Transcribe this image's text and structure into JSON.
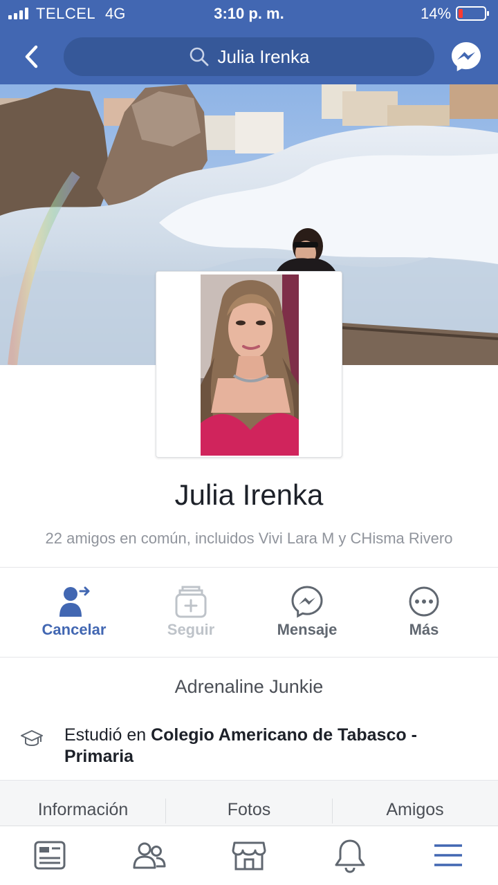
{
  "status_bar": {
    "carrier": "TELCEL",
    "network": "4G",
    "time": "3:10 p. m.",
    "battery": "14%"
  },
  "nav": {
    "search_text": "Julia Irenka",
    "back_icon": "chevron-left-icon",
    "messenger_icon": "messenger-icon"
  },
  "profile": {
    "name": "Julia Irenka",
    "mutual_friends": "22 amigos en común, incluidos Vivi Lara M y CHisma Rivero"
  },
  "actions": [
    {
      "label": "Cancelar",
      "icon": "friend-request-sent-icon"
    },
    {
      "label": "Seguir",
      "icon": "follow-icon"
    },
    {
      "label": "Mensaje",
      "icon": "messenger-icon"
    },
    {
      "label": "Más",
      "icon": "more-icon"
    }
  ],
  "intro": {
    "bio": "Adrenaline Junkie",
    "education_prefix": "Estudió en ",
    "education_school": "Colegio Americano de Tabasco - Primaria"
  },
  "tabs": [
    "Información",
    "Fotos",
    "Amigos"
  ],
  "bottom_nav": [
    "news-feed-icon",
    "friends-icon",
    "marketplace-icon",
    "notifications-icon",
    "menu-icon"
  ],
  "colors": {
    "brand": "#4267b2",
    "search_bg": "#365899",
    "active_action": "#4267b2",
    "battery_low": "#ff3b30"
  }
}
